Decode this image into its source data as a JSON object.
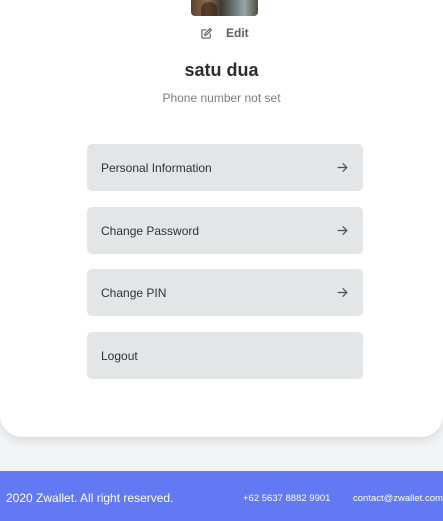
{
  "profile": {
    "edit_label": "Edit",
    "name": "satu dua",
    "phone": "Phone number not set"
  },
  "menu": [
    {
      "label": "Personal Information",
      "icon": "arrow-right-icon"
    },
    {
      "label": "Change Password",
      "icon": "arrow-right-icon"
    },
    {
      "label": "Change PIN",
      "icon": "arrow-right-icon"
    },
    {
      "label": "Logout"
    }
  ],
  "footer": {
    "copyright": "2020 Zwallet. All right reserved.",
    "phone": "+62 5637 8882 9901",
    "email": "contact@zwallet.com"
  },
  "colors": {
    "footer_bg": "#6379f4",
    "menu_bg": "#e4e5e6",
    "page_bg": "#f3f4f6"
  }
}
